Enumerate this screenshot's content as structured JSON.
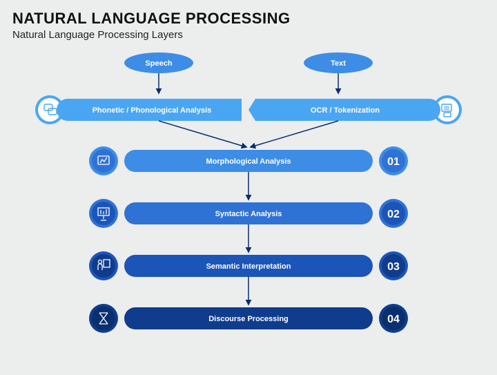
{
  "title": "NATURAL LANGUAGE PROCESSING",
  "subtitle": "Natural Language Processing Layers",
  "inputs": {
    "speech": "Speech",
    "text": "Text"
  },
  "row1": {
    "left": "Phonetic / Phonological Analysis",
    "right": "OCR / Tokenization"
  },
  "stages": [
    {
      "label": "Morphological Analysis",
      "num": "01"
    },
    {
      "label": "Syntactic Analysis",
      "num": "02"
    },
    {
      "label": "Semantic Interpretation",
      "num": "03"
    },
    {
      "label": "Discourse Processing",
      "num": "04"
    }
  ],
  "colors": {
    "c0": "#4aa6f2",
    "c1": "#3d8de6",
    "c2": "#2f72d6",
    "c3": "#1b55b8",
    "c4": "#0f3c8c",
    "c5": "#0a2f6e"
  }
}
